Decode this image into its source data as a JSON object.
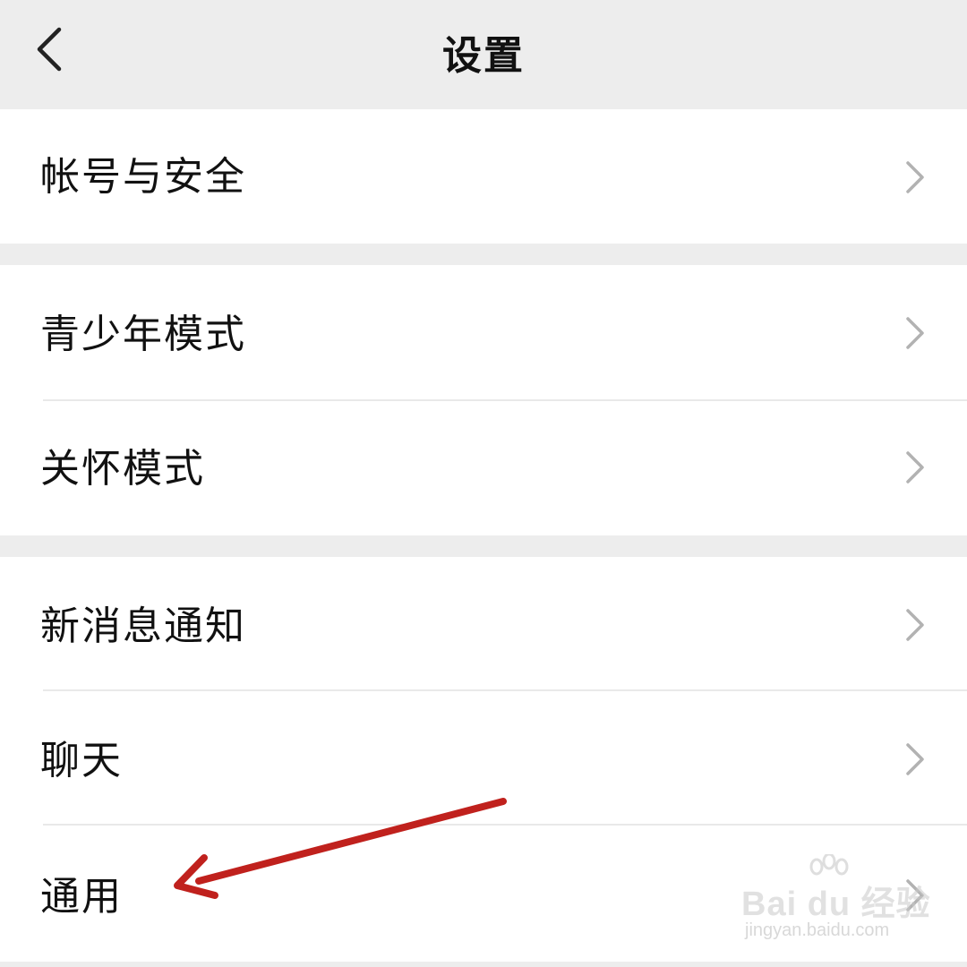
{
  "nav": {
    "title": "设置",
    "back_icon": "chevron-left-icon"
  },
  "groups": [
    {
      "items": [
        {
          "label": "帐号与安全",
          "icon": "chevron-right-icon"
        }
      ]
    },
    {
      "items": [
        {
          "label": "青少年模式",
          "icon": "chevron-right-icon"
        },
        {
          "label": "关怀模式",
          "icon": "chevron-right-icon"
        }
      ]
    },
    {
      "items": [
        {
          "label": "新消息通知",
          "icon": "chevron-right-icon"
        },
        {
          "label": "聊天",
          "icon": "chevron-right-icon"
        },
        {
          "label": "通用",
          "icon": "chevron-right-icon"
        }
      ]
    }
  ],
  "annotation": {
    "arrow_color": "#c0211d",
    "points_to": "通用"
  },
  "watermark": {
    "logo_text": "Bai  du 经验",
    "url": "jingyan.baidu.com"
  },
  "colors": {
    "background": "#ededed",
    "row_background": "#ffffff",
    "text": "#111111",
    "chevron": "#b2b2b2",
    "divider": "#e9e9e9"
  }
}
